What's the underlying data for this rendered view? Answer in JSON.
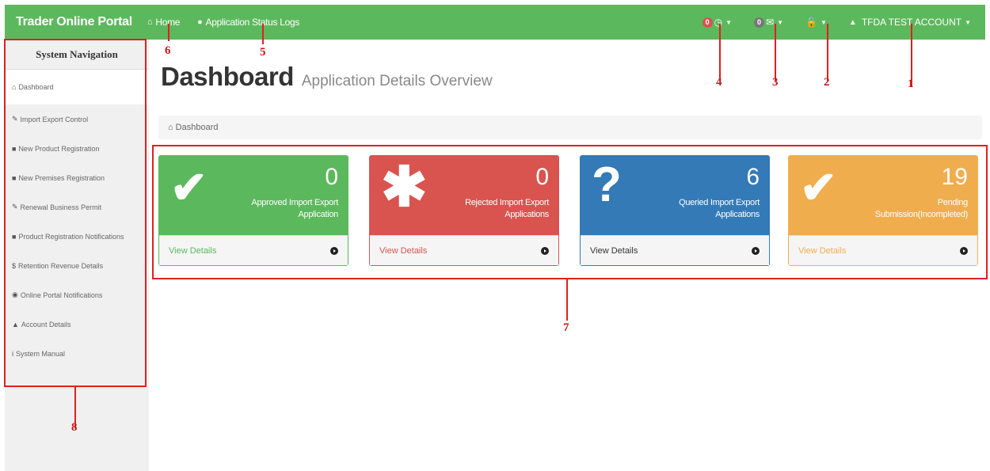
{
  "navbar": {
    "brand": "Trader Online Portal",
    "home_label": "Home",
    "logs_label": "Application Status Logs",
    "notifications_badge": "0",
    "messages_badge": "0",
    "account_label": "TFDA TEST ACCOUNT",
    "accent_color": "#5cb85c"
  },
  "sidebar": {
    "title": "System Navigation",
    "items": [
      {
        "label": "Dashboard",
        "icon": "home-icon"
      },
      {
        "label": "Import Export Control",
        "icon": "pencil-icon"
      },
      {
        "label": "New Product Registration",
        "icon": "folder-icon"
      },
      {
        "label": "New Premises Registration",
        "icon": "folder-icon"
      },
      {
        "label": "Renewal Business Permit",
        "icon": "pencil-icon"
      },
      {
        "label": "Product Registration Notifications",
        "icon": "folder-icon"
      },
      {
        "label": "Retention Revenue Details",
        "icon": "dollar-icon"
      },
      {
        "label": "Online Portal Notifications",
        "icon": "globe-icon"
      },
      {
        "label": "Account Details",
        "icon": "user-icon"
      },
      {
        "label": "System Manual",
        "icon": "info-icon"
      }
    ]
  },
  "page": {
    "title": "Dashboard",
    "subtitle": "Application Details Overview",
    "breadcrumb": "Dashboard"
  },
  "panels": [
    {
      "count": "0",
      "label": "Approved Import Export Application",
      "link": "View Details",
      "icon": "check-icon",
      "color": "#5cb85c"
    },
    {
      "count": "0",
      "label": "Rejected Import Export Applications",
      "link": "View Details",
      "icon": "asterisk-icon",
      "color": "#d9534f"
    },
    {
      "count": "6",
      "label": "Queried Import Export Applications",
      "link": "View Details",
      "icon": "question-icon",
      "color": "#337ab7"
    },
    {
      "count": "19",
      "label": "Pending Submission(Incompleted)",
      "link": "View Details",
      "icon": "check-icon",
      "color": "#f0ad4e"
    }
  ],
  "annotations": [
    "1",
    "2",
    "3",
    "4",
    "5",
    "6",
    "7",
    "8"
  ]
}
